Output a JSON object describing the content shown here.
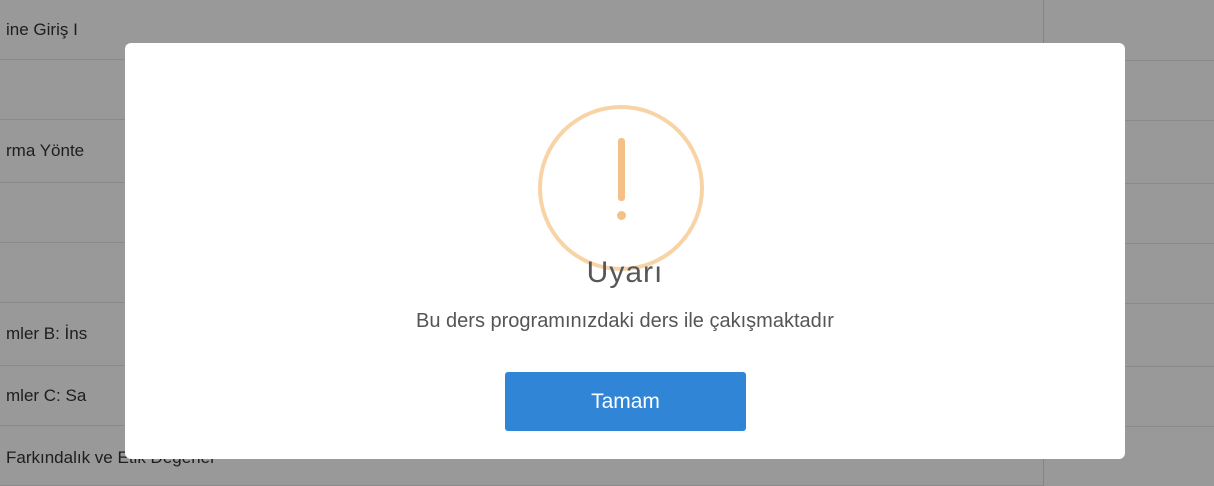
{
  "background": {
    "rows": [
      "ine Giriş I",
      "",
      "rma Yönte",
      "",
      "",
      "mler B: İns",
      "mler C: Sa",
      "Farkındalık ve Etik Değerler"
    ]
  },
  "dialog": {
    "icon": "warning-icon",
    "title": "Uyarı",
    "message": "Bu ders programınızdaki ders ile çakışmaktadır",
    "confirm_label": "Tamam",
    "accent_color": "#3085d6",
    "icon_color": "#f8bb86"
  }
}
